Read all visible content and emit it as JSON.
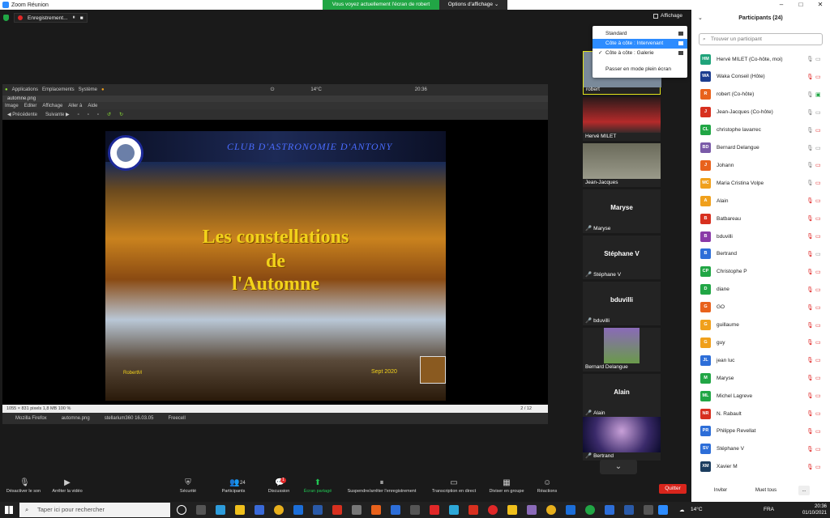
{
  "window": {
    "title": "Zoom Réunion",
    "min": "–",
    "max": "□",
    "close": "✕"
  },
  "share_banner": {
    "text": "Vous voyez actuellement l'écran de robert",
    "view_options": "Options d'affichage ⌄"
  },
  "recording": {
    "label": "Enregistrement...",
    "pause": "⏸",
    "stop": "■"
  },
  "affichage_label": "Affichage",
  "view_menu": {
    "items": [
      {
        "label": "Standard",
        "checked": false,
        "selected": false
      },
      {
        "label": "Côte à côte : Intervenant",
        "checked": false,
        "selected": true
      },
      {
        "label": "Côte à côte : Galerie",
        "checked": true,
        "selected": false
      },
      {
        "label": "Passer en mode plein écran",
        "checked": false,
        "selected": false
      }
    ]
  },
  "linux": {
    "topbar": [
      "Applications",
      "Emplacements",
      "Système"
    ],
    "weather": "14°C",
    "clock": "20:36",
    "eog_title": "automne.png",
    "eog_menu": [
      "Image",
      "Editer",
      "Affichage",
      "Aller à",
      "Aide"
    ],
    "eog_tools": [
      "Précédente",
      "Suivante"
    ],
    "status": "1055 × 831 pixels  1,8 MB  100 %",
    "page": "2 / 12",
    "taskbar": [
      "Mozilla Firefox",
      "automne.png",
      "stellarium360 16.03.05",
      "Freecell"
    ]
  },
  "slide": {
    "club": "CLUB D'ASTRONOMIE D'ANTONY",
    "line1": "Les constellations",
    "line2": "de",
    "line3": "l'Automne",
    "author": "RobertM",
    "date": "Sept 2020"
  },
  "tiles": [
    {
      "name": "robert",
      "big": "",
      "muted": false,
      "photo": true
    },
    {
      "name": "Hervé MILET",
      "big": "",
      "muted": false,
      "photo": true
    },
    {
      "name": "Jean-Jacques",
      "big": "",
      "muted": false,
      "photo": true
    },
    {
      "name": "Maryse",
      "big": "Maryse",
      "muted": true,
      "photo": false
    },
    {
      "name": "Stéphane V",
      "big": "Stéphane V",
      "muted": true,
      "photo": false
    },
    {
      "name": "bduvilli",
      "big": "bduvilli",
      "muted": true,
      "photo": false
    },
    {
      "name": "Bernard Delangue",
      "big": "",
      "muted": false,
      "photo": true
    },
    {
      "name": "Alain",
      "big": "Alain",
      "muted": true,
      "photo": false
    },
    {
      "name": "Bertrand",
      "big": "",
      "muted": true,
      "photo": true
    }
  ],
  "controls": {
    "mute": "Désactiver le son",
    "video": "Arrêter la vidéo",
    "security": "Sécurité",
    "participants": "Participants",
    "participants_count": "24",
    "chat": "Discussion",
    "chat_badge": "1",
    "share": "Écran partagé",
    "record": "Suspendre/arrêter l'enregistrement",
    "transcript": "Transcription en direct",
    "rooms": "Diviser en groupe",
    "reactions": "Réactions",
    "quit": "Quitter"
  },
  "panel": {
    "title": "Participants (24)",
    "search_placeholder": "Trouver un participant",
    "invite": "Inviter",
    "mute_all": "Muet tous",
    "more": "..."
  },
  "participants": [
    {
      "initials": "HM",
      "color": "#1fa37a",
      "name": "Hervé MILET (Co-hôte, moi)",
      "mic": "on",
      "cam": "on"
    },
    {
      "initials": "WA",
      "color": "#1c3d8f",
      "name": "Waka Conseil (Hôte)",
      "mic": "off",
      "cam": "off"
    },
    {
      "initials": "R",
      "color": "#e8621c",
      "name": "robert (Co-hôte)",
      "mic": "on",
      "cam": "share"
    },
    {
      "initials": "J",
      "color": "#d7301f",
      "name": "Jean-Jacques (Co-hôte)",
      "mic": "on",
      "cam": "on"
    },
    {
      "initials": "CL",
      "color": "#21a645",
      "name": "christophe lavarrec",
      "mic": "on",
      "cam": "off"
    },
    {
      "initials": "BD",
      "color": "#7a5aa8",
      "name": "Bernard Delangue",
      "mic": "on",
      "cam": "on"
    },
    {
      "initials": "J",
      "color": "#e8621c",
      "name": "Johann",
      "mic": "on",
      "cam": "off"
    },
    {
      "initials": "MC",
      "color": "#f0a01c",
      "name": "Maria Cristina Volpe",
      "mic": "on",
      "cam": "off"
    },
    {
      "initials": "A",
      "color": "#f0a01c",
      "name": "Alain",
      "mic": "off",
      "cam": "off"
    },
    {
      "initials": "B",
      "color": "#d7301f",
      "name": "Batbareau",
      "mic": "off",
      "cam": "off"
    },
    {
      "initials": "B",
      "color": "#8a3aa8",
      "name": "bduvilli",
      "mic": "off",
      "cam": "off"
    },
    {
      "initials": "B",
      "color": "#2d6ed8",
      "name": "Bertrand",
      "mic": "off",
      "cam": "on"
    },
    {
      "initials": "CP",
      "color": "#21a645",
      "name": "Christophe P",
      "mic": "off",
      "cam": "off"
    },
    {
      "initials": "D",
      "color": "#21a645",
      "name": "diane",
      "mic": "off",
      "cam": "off"
    },
    {
      "initials": "G",
      "color": "#e8621c",
      "name": "GO",
      "mic": "off",
      "cam": "off"
    },
    {
      "initials": "G",
      "color": "#f0a01c",
      "name": "guillaume",
      "mic": "off",
      "cam": "off"
    },
    {
      "initials": "G",
      "color": "#f0a01c",
      "name": "guy",
      "mic": "off",
      "cam": "off"
    },
    {
      "initials": "JL",
      "color": "#2d6ed8",
      "name": "jean luc",
      "mic": "off",
      "cam": "off"
    },
    {
      "initials": "M",
      "color": "#21a645",
      "name": "Maryse",
      "mic": "off",
      "cam": "off"
    },
    {
      "initials": "ML",
      "color": "#21a645",
      "name": "Michel Lagreve",
      "mic": "off",
      "cam": "off"
    },
    {
      "initials": "NR",
      "color": "#d7301f",
      "name": "N. Rabault",
      "mic": "off",
      "cam": "off"
    },
    {
      "initials": "PR",
      "color": "#2d6ed8",
      "name": "Philippe Revellat",
      "mic": "off",
      "cam": "off"
    },
    {
      "initials": "SV",
      "color": "#2d6ed8",
      "name": "Stéphane V",
      "mic": "off",
      "cam": "off"
    },
    {
      "initials": "XM",
      "color": "#1c3d5f",
      "name": "Xavier M",
      "mic": "off",
      "cam": "off"
    }
  ],
  "taskbar": {
    "search_placeholder": "Taper ici pour rechercher",
    "weather": "14°C",
    "lang": "FRA",
    "time": "20:36",
    "date": "01/10/2021"
  }
}
